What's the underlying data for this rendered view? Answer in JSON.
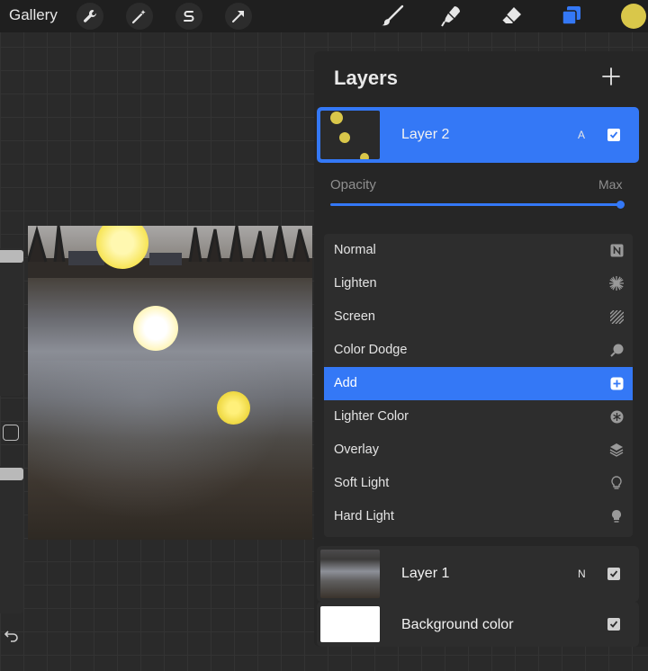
{
  "toolbar": {
    "gallery_label": "Gallery",
    "tools_left": [
      "wrench-icon",
      "magic-wand-icon",
      "selection-s-icon",
      "transform-arrow-icon"
    ],
    "tools_right": [
      "brush-icon",
      "smudge-icon",
      "eraser-icon",
      "layers-icon"
    ],
    "active_color": "#d9c74a",
    "accent": "#3478f6"
  },
  "layers_panel": {
    "title": "Layers",
    "add_icon": "plus-icon",
    "active_layer": {
      "name": "Layer 2",
      "mode_badge": "A",
      "visible": true
    },
    "opacity": {
      "label": "Opacity",
      "max_label": "Max",
      "value": 1.0
    },
    "blend_modes": [
      {
        "label": "Normal",
        "icon": "n-badge-icon",
        "selected": false
      },
      {
        "label": "Lighten",
        "icon": "starburst-icon",
        "selected": false
      },
      {
        "label": "Screen",
        "icon": "hatch-icon",
        "selected": false
      },
      {
        "label": "Color Dodge",
        "icon": "dodge-icon",
        "selected": false
      },
      {
        "label": "Add",
        "icon": "plus-square-icon",
        "selected": true
      },
      {
        "label": "Lighter Color",
        "icon": "asterisk-circle-icon",
        "selected": false
      },
      {
        "label": "Overlay",
        "icon": "stack-icon",
        "selected": false
      },
      {
        "label": "Soft Light",
        "icon": "bulb-icon",
        "selected": false
      },
      {
        "label": "Hard Light",
        "icon": "bulb-filled-icon",
        "selected": false
      }
    ],
    "other_layers": [
      {
        "name": "Layer 1",
        "mode_badge": "N",
        "visible": true
      },
      {
        "name": "Background color",
        "mode_badge": "",
        "visible": true
      }
    ]
  }
}
